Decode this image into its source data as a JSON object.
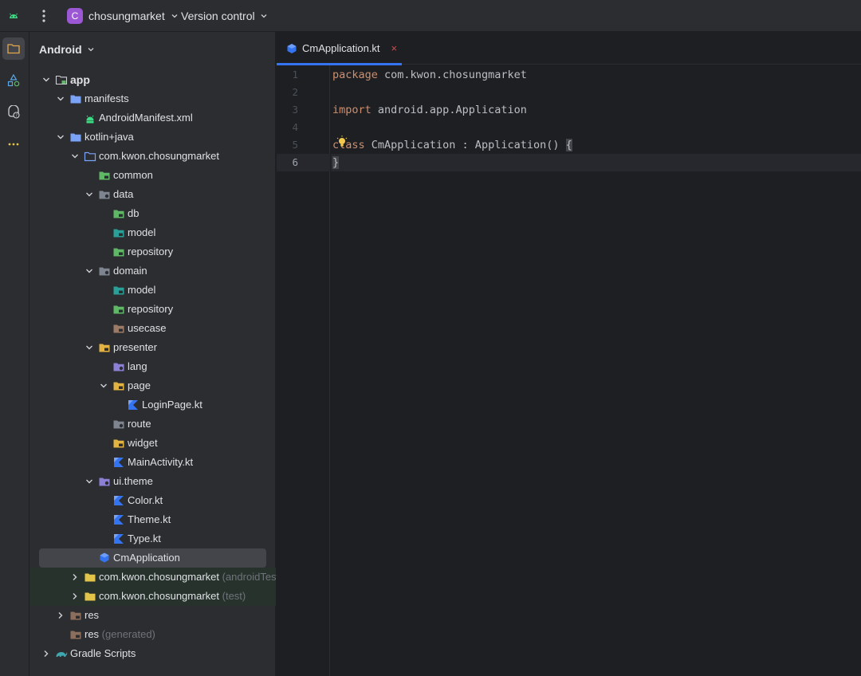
{
  "titlebar": {
    "project_badge": "C",
    "project_name": "chosungmarket",
    "vcs_label": "Version control"
  },
  "panel": {
    "header": "Android",
    "tree": [
      {
        "label": "app",
        "depth": 0,
        "expanded": true,
        "icon": "module-folder-icon",
        "bold": true
      },
      {
        "label": "manifests",
        "depth": 1,
        "expanded": true,
        "icon": "folder-icon"
      },
      {
        "label": "AndroidManifest.xml",
        "depth": 2,
        "icon": "android-icon"
      },
      {
        "label": "kotlin+java",
        "depth": 1,
        "expanded": true,
        "icon": "folder-icon"
      },
      {
        "label": "com.kwon.chosungmarket",
        "depth": 2,
        "expanded": true,
        "icon": "package-icon"
      },
      {
        "label": "common",
        "depth": 3,
        "icon": "package-green-icon"
      },
      {
        "label": "data",
        "depth": 3,
        "expanded": true,
        "icon": "package-grey-icon"
      },
      {
        "label": "db",
        "depth": 4,
        "icon": "package-green-icon"
      },
      {
        "label": "model",
        "depth": 4,
        "icon": "package-teal-icon"
      },
      {
        "label": "repository",
        "depth": 4,
        "icon": "package-green-icon"
      },
      {
        "label": "domain",
        "depth": 3,
        "expanded": true,
        "icon": "package-grey-icon"
      },
      {
        "label": "model",
        "depth": 4,
        "icon": "package-teal-icon"
      },
      {
        "label": "repository",
        "depth": 4,
        "icon": "package-green-icon"
      },
      {
        "label": "usecase",
        "depth": 4,
        "icon": "package-brown-icon"
      },
      {
        "label": "presenter",
        "depth": 3,
        "expanded": true,
        "icon": "package-yellow-icon"
      },
      {
        "label": "lang",
        "depth": 4,
        "icon": "package-purple-icon"
      },
      {
        "label": "page",
        "depth": 4,
        "expanded": true,
        "icon": "package-yellow-icon"
      },
      {
        "label": "LoginPage.kt",
        "depth": 5,
        "icon": "kotlin-icon"
      },
      {
        "label": "route",
        "depth": 4,
        "icon": "package-grey-icon"
      },
      {
        "label": "widget",
        "depth": 4,
        "icon": "package-yellow-icon"
      },
      {
        "label": "MainActivity.kt",
        "depth": 4,
        "icon": "kotlin-icon"
      },
      {
        "label": "ui.theme",
        "depth": 3,
        "expanded": true,
        "icon": "package-purple-icon"
      },
      {
        "label": "Color.kt",
        "depth": 4,
        "icon": "kotlin-icon"
      },
      {
        "label": "Theme.kt",
        "depth": 4,
        "icon": "kotlin-icon"
      },
      {
        "label": "Type.kt",
        "depth": 4,
        "icon": "kotlin-icon"
      },
      {
        "label": "CmApplication",
        "depth": 3,
        "icon": "kotlin-class-icon",
        "selected": true
      },
      {
        "label": "com.kwon.chosungmarket",
        "meta": "(androidTest)",
        "depth": 2,
        "expanded": false,
        "icon": "folder-yellow-icon",
        "tinted": true
      },
      {
        "label": "com.kwon.chosungmarket",
        "meta": "(test)",
        "depth": 2,
        "expanded": false,
        "icon": "folder-yellow-icon",
        "tinted": true
      },
      {
        "label": "res",
        "depth": 1,
        "expanded": false,
        "icon": "res-folder-icon"
      },
      {
        "label": "res",
        "meta": "(generated)",
        "depth": 1,
        "icon": "res-folder-icon"
      },
      {
        "label": "Gradle Scripts",
        "depth": 0,
        "expanded": false,
        "icon": "gradle-icon"
      }
    ]
  },
  "editor": {
    "tab_label": "CmApplication.kt",
    "tab_close": "×",
    "lines": [
      {
        "num": "1",
        "tokens": [
          {
            "t": "package",
            "c": "kw"
          },
          {
            "t": " com.kwon.chosungmarket",
            "c": "id"
          }
        ]
      },
      {
        "num": "2",
        "tokens": []
      },
      {
        "num": "3",
        "tokens": [
          {
            "t": "import",
            "c": "kw"
          },
          {
            "t": " android.app.Application",
            "c": "id"
          }
        ]
      },
      {
        "num": "4",
        "tokens": []
      },
      {
        "num": "5",
        "tokens": [
          {
            "t": "class",
            "c": "kw"
          },
          {
            "t": " CmApplication : Application() ",
            "c": "id"
          },
          {
            "t": "{",
            "c": "brace"
          }
        ]
      },
      {
        "num": "6",
        "tokens": [
          {
            "t": "}",
            "c": "brace"
          }
        ],
        "current": true
      }
    ]
  },
  "colors": {
    "accent": "#3574f0",
    "panel_bg": "#2b2d30",
    "editor_bg": "#1e1f22",
    "keyword": "#cf8e6d"
  }
}
